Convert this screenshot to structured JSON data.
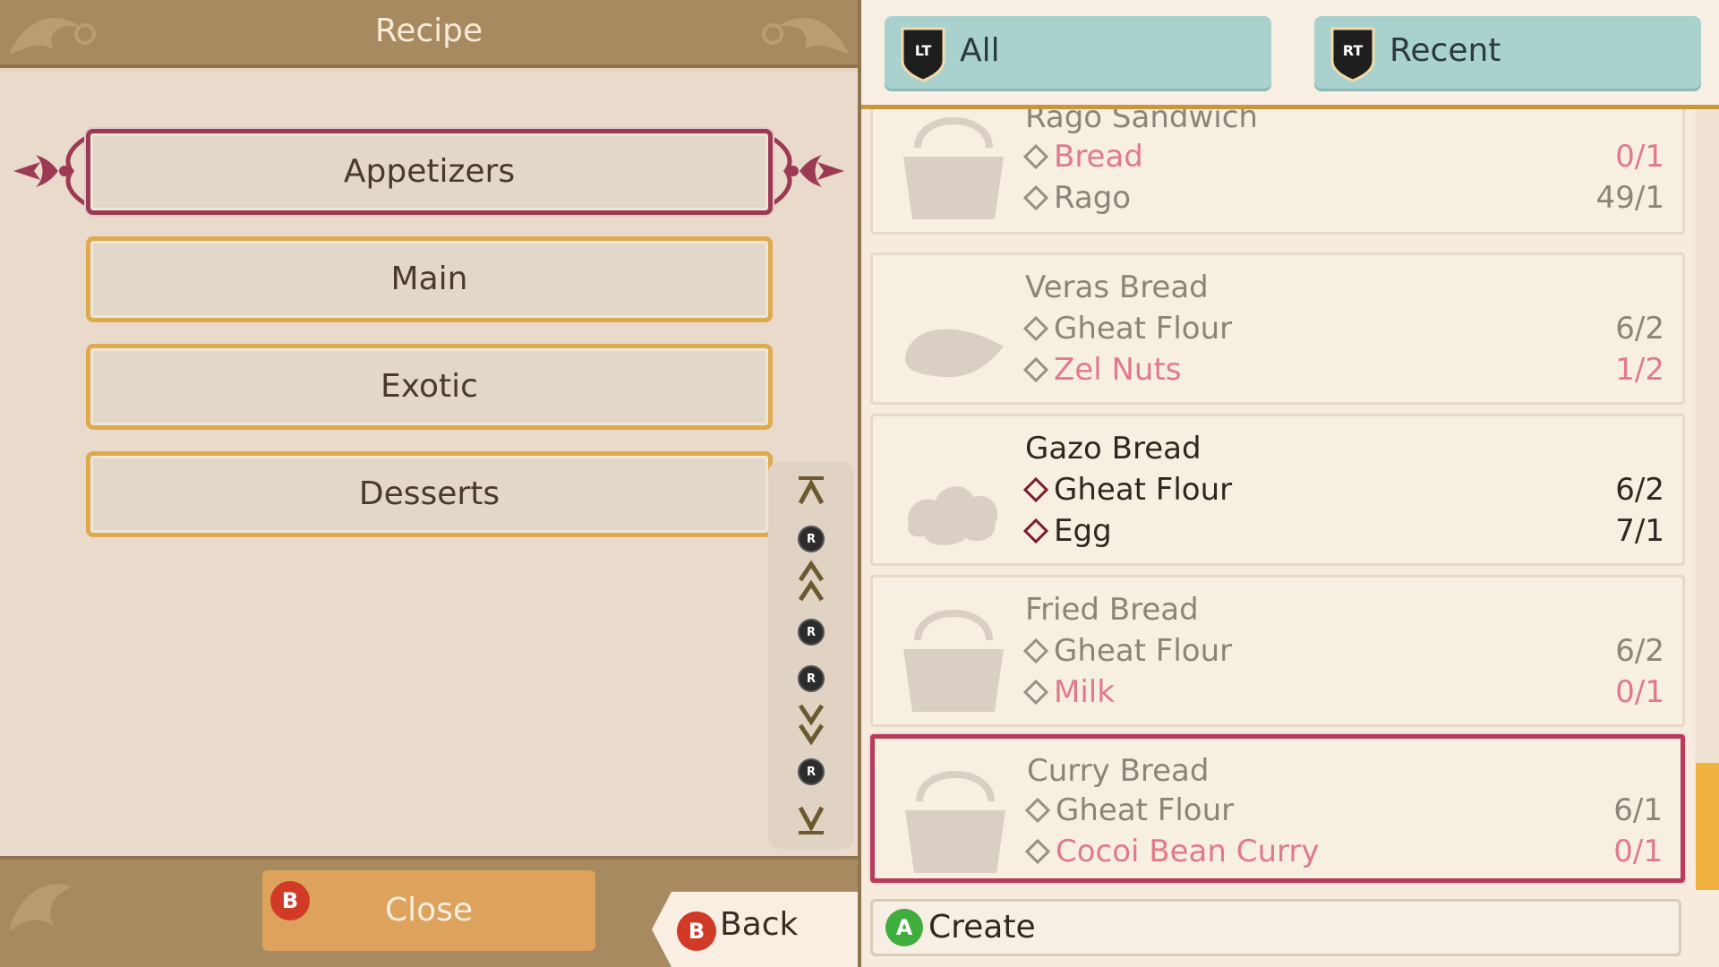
{
  "header": {
    "title": "Recipe"
  },
  "categories": [
    {
      "label": "Appetizers",
      "selected": true
    },
    {
      "label": "Main",
      "selected": false
    },
    {
      "label": "Exotic",
      "selected": false
    },
    {
      "label": "Desserts",
      "selected": false
    }
  ],
  "scroll_rail": {
    "badge": "R"
  },
  "footer": {
    "close_button_key": "B",
    "close_label": "Close",
    "back_key": "B",
    "back_label": "Back"
  },
  "tabs": [
    {
      "key": "LT",
      "label": "All"
    },
    {
      "key": "RT",
      "label": "Recent"
    }
  ],
  "recipes": [
    {
      "name": "Rago Sandwich",
      "icon": "basket-icon",
      "ingredients": [
        {
          "name": "Bread",
          "qty": "0/1",
          "short": true
        },
        {
          "name": "Rago",
          "qty": "49/1",
          "short": false
        }
      ]
    },
    {
      "name": "Veras Bread",
      "icon": "loaf-icon",
      "ingredients": [
        {
          "name": "Gheat Flour",
          "qty": "6/2",
          "short": false
        },
        {
          "name": "Zel Nuts",
          "qty": "1/2",
          "short": true
        }
      ]
    },
    {
      "name": "Gazo Bread",
      "icon": "bun-icon",
      "active": true,
      "ingredients": [
        {
          "name": "Gheat Flour",
          "qty": "6/2",
          "short": false
        },
        {
          "name": "Egg",
          "qty": "7/1",
          "short": false
        }
      ]
    },
    {
      "name": "Fried Bread",
      "icon": "basket-icon",
      "ingredients": [
        {
          "name": "Gheat Flour",
          "qty": "6/2",
          "short": false
        },
        {
          "name": "Milk",
          "qty": "0/1",
          "short": true
        }
      ]
    },
    {
      "name": "Curry Bread",
      "icon": "basket-icon",
      "selected": true,
      "ingredients": [
        {
          "name": "Gheat Flour",
          "qty": "6/1",
          "short": false
        },
        {
          "name": "Cocoi Bean Curry",
          "qty": "0/1",
          "short": true
        }
      ]
    }
  ],
  "create": {
    "key": "A",
    "label": "Create"
  },
  "colors": {
    "selected_border": "#b83c5a",
    "category_border": "#dfa94e",
    "tab_bg": "#a9d2cf",
    "short_text": "#e07a8a",
    "scroll_thumb": "#f0b23e"
  }
}
